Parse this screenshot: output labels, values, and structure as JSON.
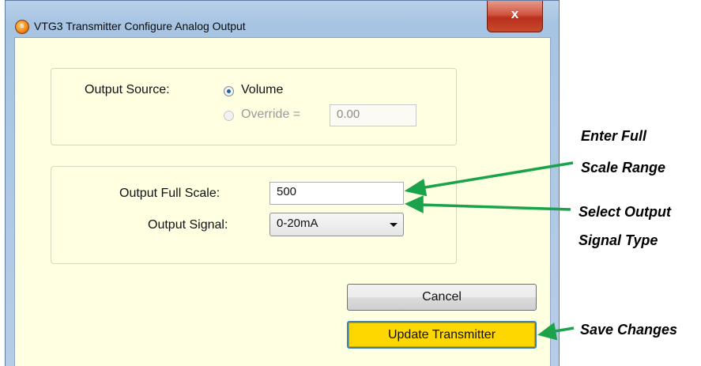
{
  "window": {
    "title": "VTG3 Transmitter Configure Analog Output",
    "close_label": "x",
    "app_icon": "app-logo-icon"
  },
  "source_group": {
    "label": "Output Source:",
    "options": [
      {
        "label": "Volume",
        "selected": true,
        "enabled": true
      },
      {
        "label": "Override =",
        "selected": false,
        "enabled": false
      }
    ],
    "override_value": "0.00"
  },
  "output_group": {
    "full_scale_label": "Output Full Scale:",
    "full_scale_value": "500",
    "signal_label": "Output Signal:",
    "signal_value": "0-20mA"
  },
  "buttons": {
    "cancel": "Cancel",
    "update": "Update Transmitter"
  },
  "annotations": {
    "full_scale_line1": "Enter Full",
    "full_scale_line2": "Scale Range",
    "signal_line1": "Select Output",
    "signal_line2": "Signal Type",
    "save": "Save Changes"
  },
  "colors": {
    "client_bg": "#ffffe1",
    "update_button": "#ffd700",
    "arrow": "#1aa34a"
  }
}
